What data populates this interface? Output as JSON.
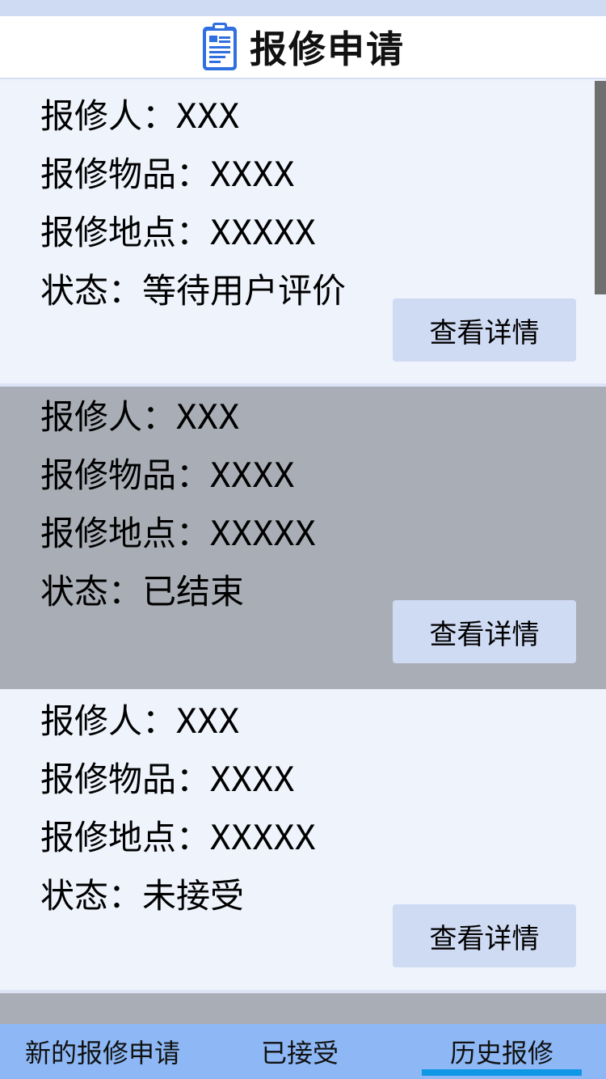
{
  "header": {
    "title": "报修申请",
    "icon": "clipboard-document-icon"
  },
  "cards": [
    {
      "reporter_label": "报修人：",
      "reporter": "XXX",
      "item_label": "报修物品：",
      "item": "XXXX",
      "location_label": "报修地点：",
      "location": "XXXXX",
      "status_label": "状态：",
      "status": "等待用户评价",
      "button": "查看详情"
    },
    {
      "reporter_label": "报修人：",
      "reporter": "XXX",
      "item_label": "报修物品：",
      "item": "XXXX",
      "location_label": "报修地点：",
      "location": "XXXXX",
      "status_label": "状态：",
      "status": "已结束",
      "button": "查看详情"
    },
    {
      "reporter_label": "报修人：",
      "reporter": "XXX",
      "item_label": "报修物品：",
      "item": "XXXX",
      "location_label": "报修地点：",
      "location": "XXXXX",
      "status_label": "状态：",
      "status": "未接受",
      "button": "查看详情"
    }
  ],
  "tabs": [
    {
      "label": "新的报修申请",
      "active": false
    },
    {
      "label": "已接受",
      "active": false
    },
    {
      "label": "历史报修",
      "active": true
    }
  ],
  "colors": {
    "header_bg": "#ffffff",
    "card_light": "#eff3fc",
    "card_grey": "#a9adb5",
    "button_bg": "#cfdaf3",
    "tabbar_bg": "#8db8f5",
    "tab_active_underline": "#0f97e5"
  }
}
